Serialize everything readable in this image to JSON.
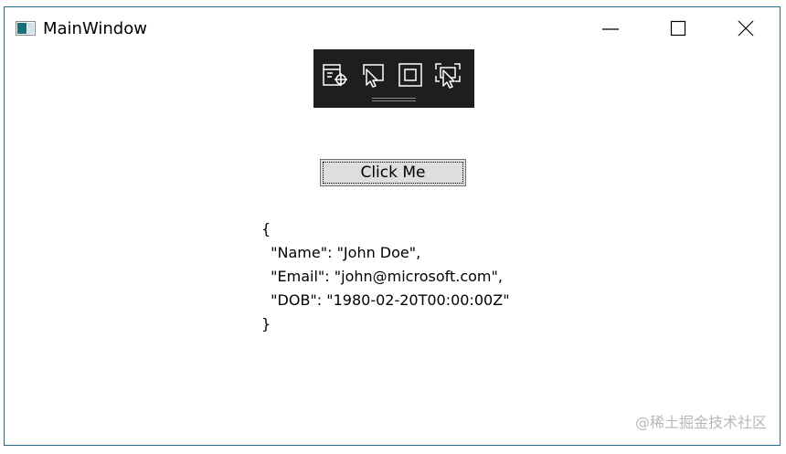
{
  "window": {
    "title": "MainWindow",
    "controls": {
      "minimize_icon": "minimize-icon",
      "maximize_icon": "maximize-icon",
      "close_icon": "close-icon"
    }
  },
  "debug_toolbar": {
    "icons": [
      "select-element-icon",
      "display-layout-adorners-icon",
      "track-focused-element-icon",
      "hot-reload-selection-icon"
    ]
  },
  "main": {
    "button_label": "Click Me",
    "json_lines": [
      "{",
      "  \"Name\": \"John Doe\",",
      "  \"Email\": \"john@microsoft.com\",",
      "  \"DOB\": \"1980-02-20T00:00:00Z\"",
      "}"
    ]
  },
  "watermark": "@稀土掘金技术社区",
  "colors": {
    "window_border": "#2b6c86",
    "toolbar_bg": "#1e1e1e",
    "button_bg": "#dedede"
  }
}
